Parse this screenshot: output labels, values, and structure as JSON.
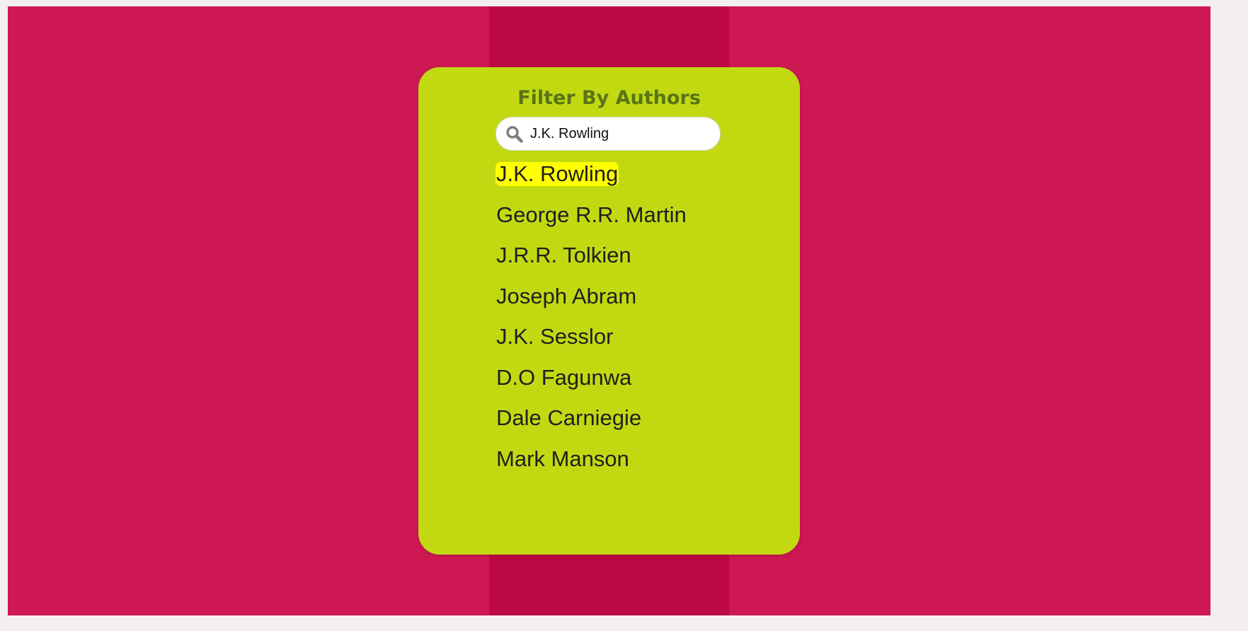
{
  "filter": {
    "title": "Filter By Authors",
    "search_value": "J.K. Rowling",
    "search_icon": "search-icon"
  },
  "authors": [
    {
      "name": "J.K. Rowling",
      "highlighted": true
    },
    {
      "name": "George R.R. Martin",
      "highlighted": false
    },
    {
      "name": "J.R.R. Tolkien",
      "highlighted": false
    },
    {
      "name": "Joseph Abram",
      "highlighted": false
    },
    {
      "name": "J.K. Sesslor",
      "highlighted": false
    },
    {
      "name": "D.O Fagunwa",
      "highlighted": false
    },
    {
      "name": "Dale Carniegie",
      "highlighted": false
    },
    {
      "name": "Mark Manson",
      "highlighted": false
    }
  ],
  "colors": {
    "page_background": "#cd1853",
    "center_stripe": "#bc0845",
    "card_background": "#c2d912",
    "title_color": "#587416",
    "highlight": "#ffff00"
  }
}
